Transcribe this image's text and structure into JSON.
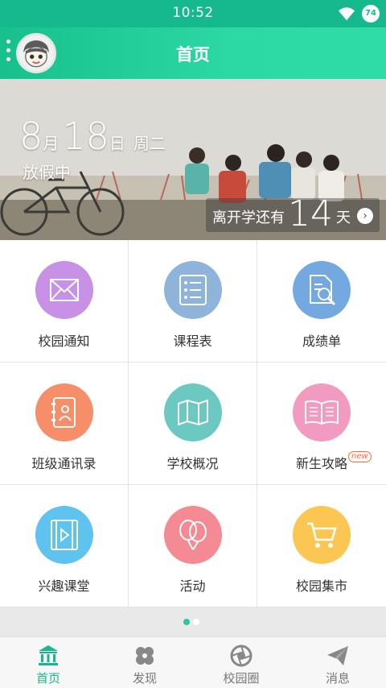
{
  "status_bar": {
    "time": "10:52",
    "battery": "74"
  },
  "app_bar": {
    "title": "首页"
  },
  "banner": {
    "month": "8",
    "month_unit": "月",
    "day": "18",
    "day_unit": "日",
    "weekday": "周二",
    "status": "放假中",
    "countdown_label": "离开学还有",
    "countdown_days": "14",
    "countdown_unit": "天"
  },
  "features": [
    {
      "label": "校园通知",
      "icon": "envelope-icon",
      "color": "#c791e6"
    },
    {
      "label": "课程表",
      "icon": "list-icon",
      "color": "#8fb4d9"
    },
    {
      "label": "成绩单",
      "icon": "document-search-icon",
      "color": "#73a8e0"
    },
    {
      "label": "班级通讯录",
      "icon": "contacts-book-icon",
      "color": "#f78e6a"
    },
    {
      "label": "学校概况",
      "icon": "map-icon",
      "color": "#6cc9c2"
    },
    {
      "label": "新生攻略",
      "icon": "open-book-icon",
      "color": "#f29ac0",
      "badge": "new"
    },
    {
      "label": "兴趣课堂",
      "icon": "video-icon",
      "color": "#5ec3ee"
    },
    {
      "label": "活动",
      "icon": "balloons-icon",
      "color": "#f48b94"
    },
    {
      "label": "校园集市",
      "icon": "cart-icon",
      "color": "#fcc652"
    }
  ],
  "pager": {
    "pages": 2,
    "active": 1,
    "active_color": "#28c9a0",
    "inactive_color": "#ffffff"
  },
  "tabs": [
    {
      "label": "首页",
      "icon": "school-building-icon",
      "active": true
    },
    {
      "label": "发现",
      "icon": "clover-icon",
      "active": false
    },
    {
      "label": "校园圈",
      "icon": "camera-aperture-icon",
      "active": false
    },
    {
      "label": "消息",
      "icon": "paper-plane-icon",
      "active": false
    }
  ],
  "colors": {
    "accent": "#16b88d",
    "tab_inactive": "#888888"
  }
}
